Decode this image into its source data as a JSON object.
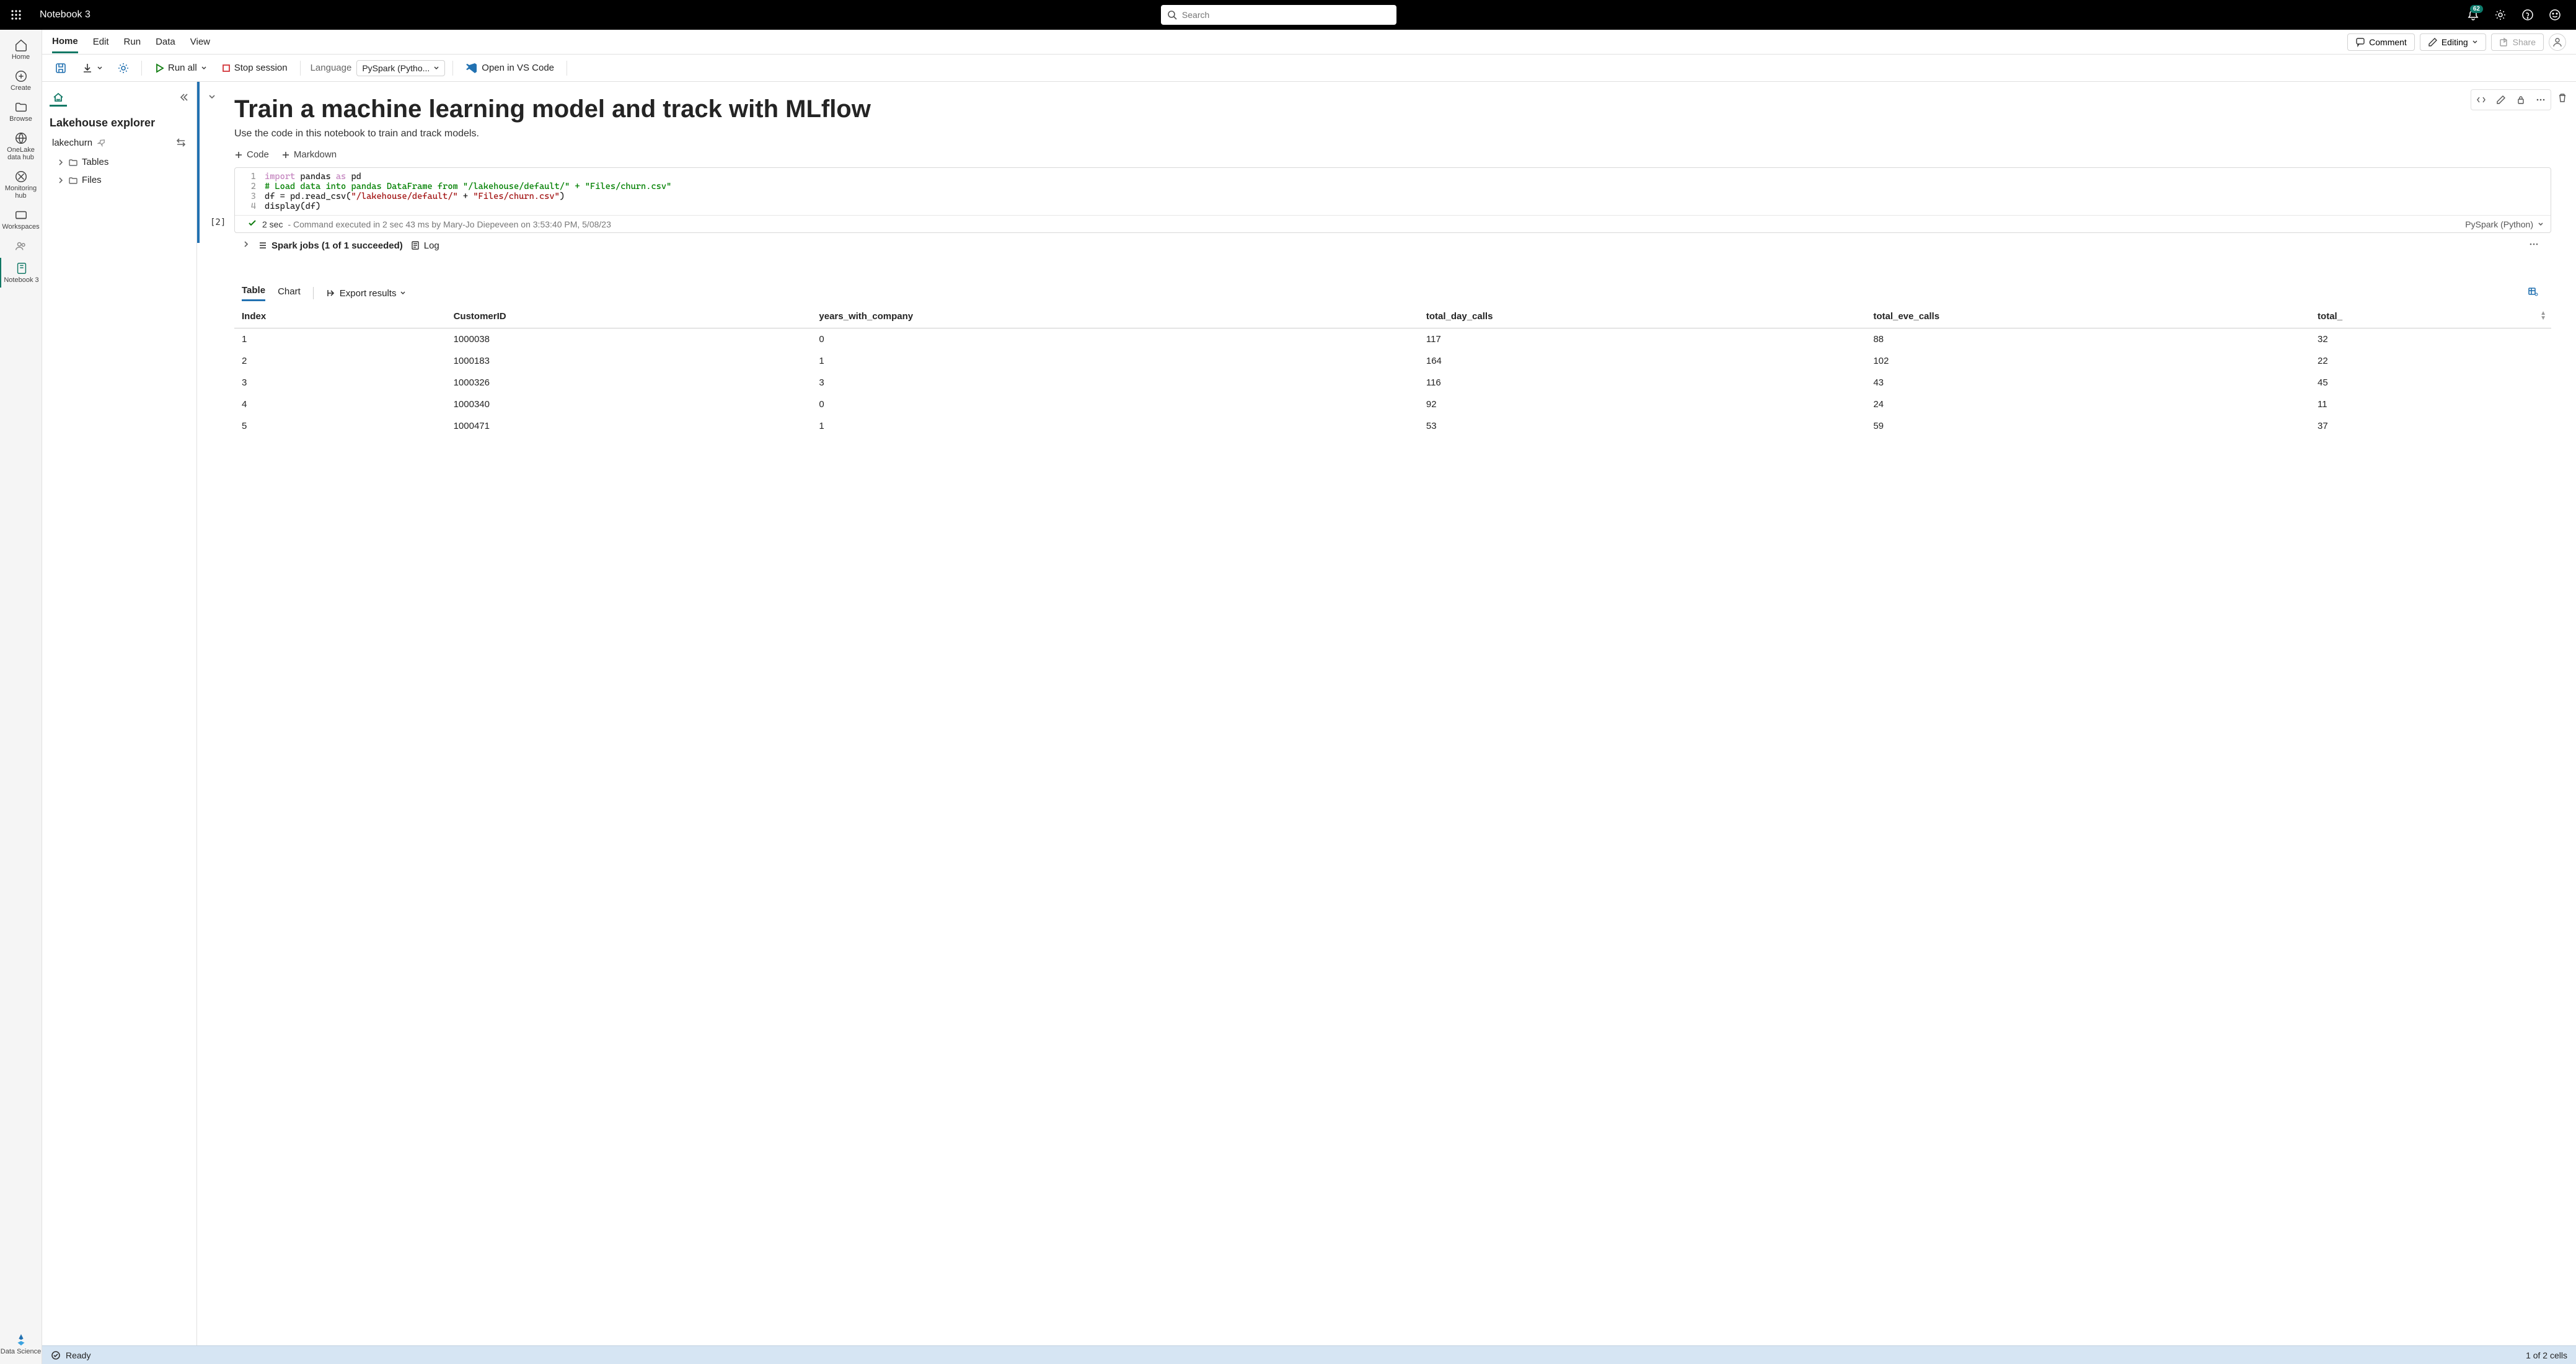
{
  "topbar": {
    "title": "Notebook 3",
    "search_placeholder": "Search",
    "notif_count": "62"
  },
  "leftrail": {
    "items": [
      {
        "label": "Home"
      },
      {
        "label": "Create"
      },
      {
        "label": "Browse"
      },
      {
        "label": "OneLake data hub"
      },
      {
        "label": "Monitoring hub"
      },
      {
        "label": "Workspaces"
      },
      {
        "label": ""
      },
      {
        "label": "Notebook 3"
      }
    ],
    "footer": {
      "label": "Data Science"
    }
  },
  "menubar": {
    "items": [
      "Home",
      "Edit",
      "Run",
      "Data",
      "View"
    ],
    "comment": "Comment",
    "editing": "Editing",
    "share": "Share"
  },
  "toolbar": {
    "run_all": "Run all",
    "stop": "Stop session",
    "language_label": "Language",
    "language_value": "PySpark (Pytho...",
    "open_vs": "Open in VS Code"
  },
  "explorer": {
    "title": "Lakehouse explorer",
    "lakehouse": "lakechurn",
    "nodes": [
      "Tables",
      "Files"
    ]
  },
  "notebook": {
    "title": "Train a machine learning model and track with MLflow",
    "subtitle": "Use the code in this notebook to train and track models.",
    "add_code": "Code",
    "add_markdown": "Markdown",
    "code": {
      "l1a": "import",
      "l1b": " pandas ",
      "l1c": "as",
      "l1d": " pd",
      "l2": "# Load data into pandas DataFrame from \"/lakehouse/default/\" + \"Files/churn.csv\"",
      "l3a": "df = pd.read_csv(",
      "l3b": "\"/lakehouse/default/\"",
      "l3c": " + ",
      "l3d": "\"Files/churn.csv\"",
      "l3e": ")",
      "l4": "display(df)"
    },
    "exec_index": "[2]",
    "exec_time": "2 sec",
    "exec_msg": "- Command executed in 2 sec 43 ms by Mary-Jo Diepeveen on 3:53:40 PM, 5/08/23",
    "pyspark": "PySpark (Python)",
    "spark_jobs": "Spark jobs (1 of 1 succeeded)",
    "log": "Log"
  },
  "output": {
    "tab_table": "Table",
    "tab_chart": "Chart",
    "export": "Export results",
    "columns": [
      "Index",
      "CustomerID",
      "years_with_company",
      "total_day_calls",
      "total_eve_calls",
      "total_"
    ],
    "rows": [
      [
        "1",
        "1000038",
        "0",
        "117",
        "88",
        "32"
      ],
      [
        "2",
        "1000183",
        "1",
        "164",
        "102",
        "22"
      ],
      [
        "3",
        "1000326",
        "3",
        "116",
        "43",
        "45"
      ],
      [
        "4",
        "1000340",
        "0",
        "92",
        "24",
        "11"
      ],
      [
        "5",
        "1000471",
        "1",
        "53",
        "59",
        "37"
      ]
    ]
  },
  "status": {
    "text": "Ready",
    "cells": "1 of 2 cells"
  }
}
